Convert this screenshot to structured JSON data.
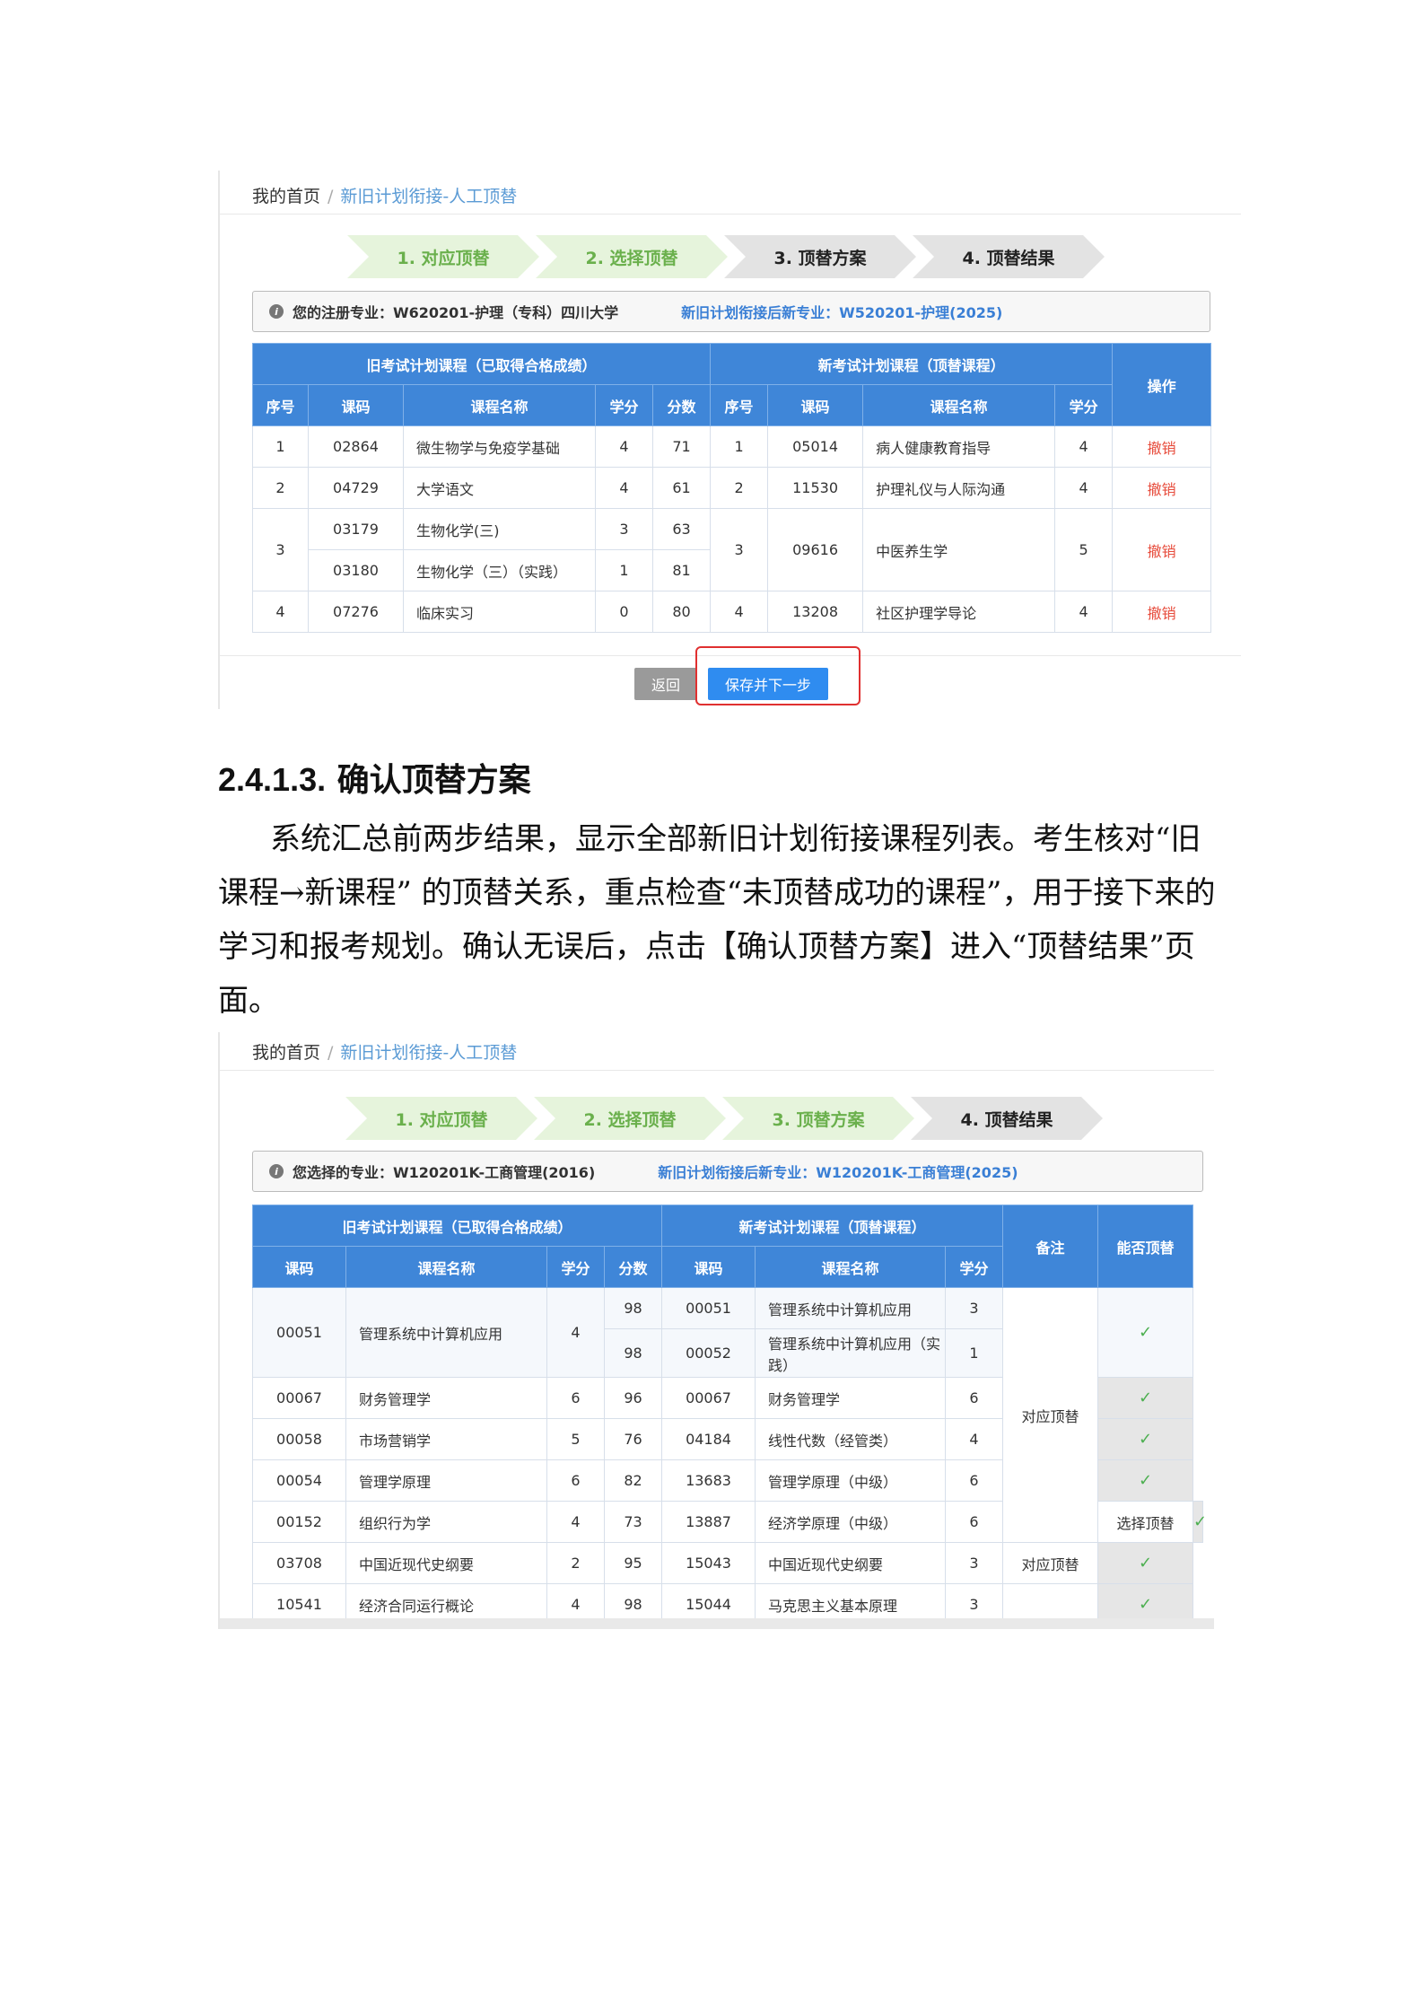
{
  "shot1": {
    "breadcrumb": {
      "home": "我的首页",
      "sep": "/",
      "current": "新旧计划衔接-人工顶替"
    },
    "steps": [
      "1. 对应顶替",
      "2. 选择顶替",
      "3. 顶替方案",
      "4. 顶替结果"
    ],
    "info": {
      "label": "您的注册专业：W620201-护理（专科）四川大学",
      "new": "新旧计划衔接后新专业：W520201-护理(2025)"
    },
    "table": {
      "group_old": "旧考试计划课程（已取得合格成绩）",
      "group_new": "新考试计划课程（顶替课程）",
      "op": "操作",
      "cols_old": [
        "序号",
        "课码",
        "课程名称",
        "学分",
        "分数"
      ],
      "cols_new": [
        "序号",
        "课码",
        "课程名称",
        "学分"
      ],
      "rows": [
        {
          "no": "1",
          "code": "02864",
          "name": "微生物学与免疫学基础",
          "credit": "4",
          "score": "71",
          "nno": "1",
          "ncode": "05014",
          "nname": "病人健康教育指导",
          "ncredit": "4",
          "action": "撤销"
        },
        {
          "no": "2",
          "code": "04729",
          "name": "大学语文",
          "credit": "4",
          "score": "61",
          "nno": "2",
          "ncode": "11530",
          "nname": "护理礼仪与人际沟通",
          "ncredit": "4",
          "action": "撤销"
        },
        {
          "no": "3",
          "code": "03179",
          "name": "生物化学(三)",
          "credit": "3",
          "score": "63",
          "nno": "3",
          "ncode": "09616",
          "nname": "中医养生学",
          "ncredit": "5",
          "action": "撤销"
        },
        {
          "code": "03180",
          "name": "生物化学（三）（实践）",
          "credit": "1",
          "score": "81"
        },
        {
          "no": "4",
          "code": "07276",
          "name": "临床实习",
          "credit": "0",
          "score": "80",
          "nno": "4",
          "ncode": "13208",
          "nname": "社区护理学导论",
          "ncredit": "4",
          "action": "撤销"
        }
      ]
    },
    "buttons": {
      "back": "返回",
      "save": "保存并下一步"
    }
  },
  "section": {
    "number": "2.4.1.3.",
    "title": "确认顶替方案",
    "text": "系统汇总前两步结果，显示全部新旧计划衔接课程列表。考生核对“旧课程→新课程” 的顶替关系，重点检查“未顶替成功的课程”，用于接下来的学习和报考规划。确认无误后，点击【确认顶替方案】进入“顶替结果”页面。"
  },
  "shot2": {
    "breadcrumb": {
      "home": "我的首页",
      "sep": "/",
      "current": "新旧计划衔接-人工顶替"
    },
    "steps": [
      "1. 对应顶替",
      "2. 选择顶替",
      "3. 顶替方案",
      "4. 顶替结果"
    ],
    "info": {
      "label": "您选择的专业：W120201K-工商管理(2016)",
      "new": "新旧计划衔接后新专业：W120201K-工商管理(2025)"
    },
    "table": {
      "group_old": "旧考试计划课程（已取得合格成绩）",
      "group_new": "新考试计划课程（顶替课程）",
      "remark": "备注",
      "can": "能否顶替",
      "cols_old": [
        "课码",
        "课程名称",
        "学分",
        "分数"
      ],
      "cols_new": [
        "课码",
        "课程名称",
        "学分"
      ],
      "check": "✓",
      "rows": [
        {
          "code": "00051",
          "name": "管理系统中计算机应用",
          "credit": "4",
          "score": "98",
          "ncode": "00051",
          "nname": "管理系统中计算机应用",
          "ncredit": "3"
        },
        {
          "score": "98",
          "ncode": "00052",
          "nname": "管理系统中计算机应用（实践）",
          "ncredit": "1"
        },
        {
          "code": "00067",
          "name": "财务管理学",
          "credit": "6",
          "score": "96",
          "ncode": "00067",
          "nname": "财务管理学",
          "ncredit": "6"
        },
        {
          "code": "00058",
          "name": "市场营销学",
          "credit": "5",
          "score": "76",
          "ncode": "04184",
          "nname": "线性代数（经管类）",
          "ncredit": "4"
        },
        {
          "code": "00054",
          "name": "管理学原理",
          "credit": "6",
          "score": "82",
          "ncode": "13683",
          "nname": "管理学原理（中级）",
          "ncredit": "6"
        },
        {
          "code": "00152",
          "name": "组织行为学",
          "credit": "4",
          "score": "73",
          "ncode": "13887",
          "nname": "经济学原理（中级）",
          "ncredit": "6",
          "remark": "选择顶替"
        },
        {
          "code": "03708",
          "name": "中国近现代史纲要",
          "credit": "2",
          "score": "95",
          "ncode": "15043",
          "nname": "中国近现代史纲要",
          "ncredit": "3",
          "remark": "对应顶替"
        },
        {
          "code": "10541",
          "name": "经济合同运行概论",
          "credit": "4",
          "score": "98",
          "ncode": "15044",
          "nname": "马克思主义基本原理",
          "ncredit": "3"
        }
      ],
      "merged_remark": "对应顶替"
    }
  }
}
